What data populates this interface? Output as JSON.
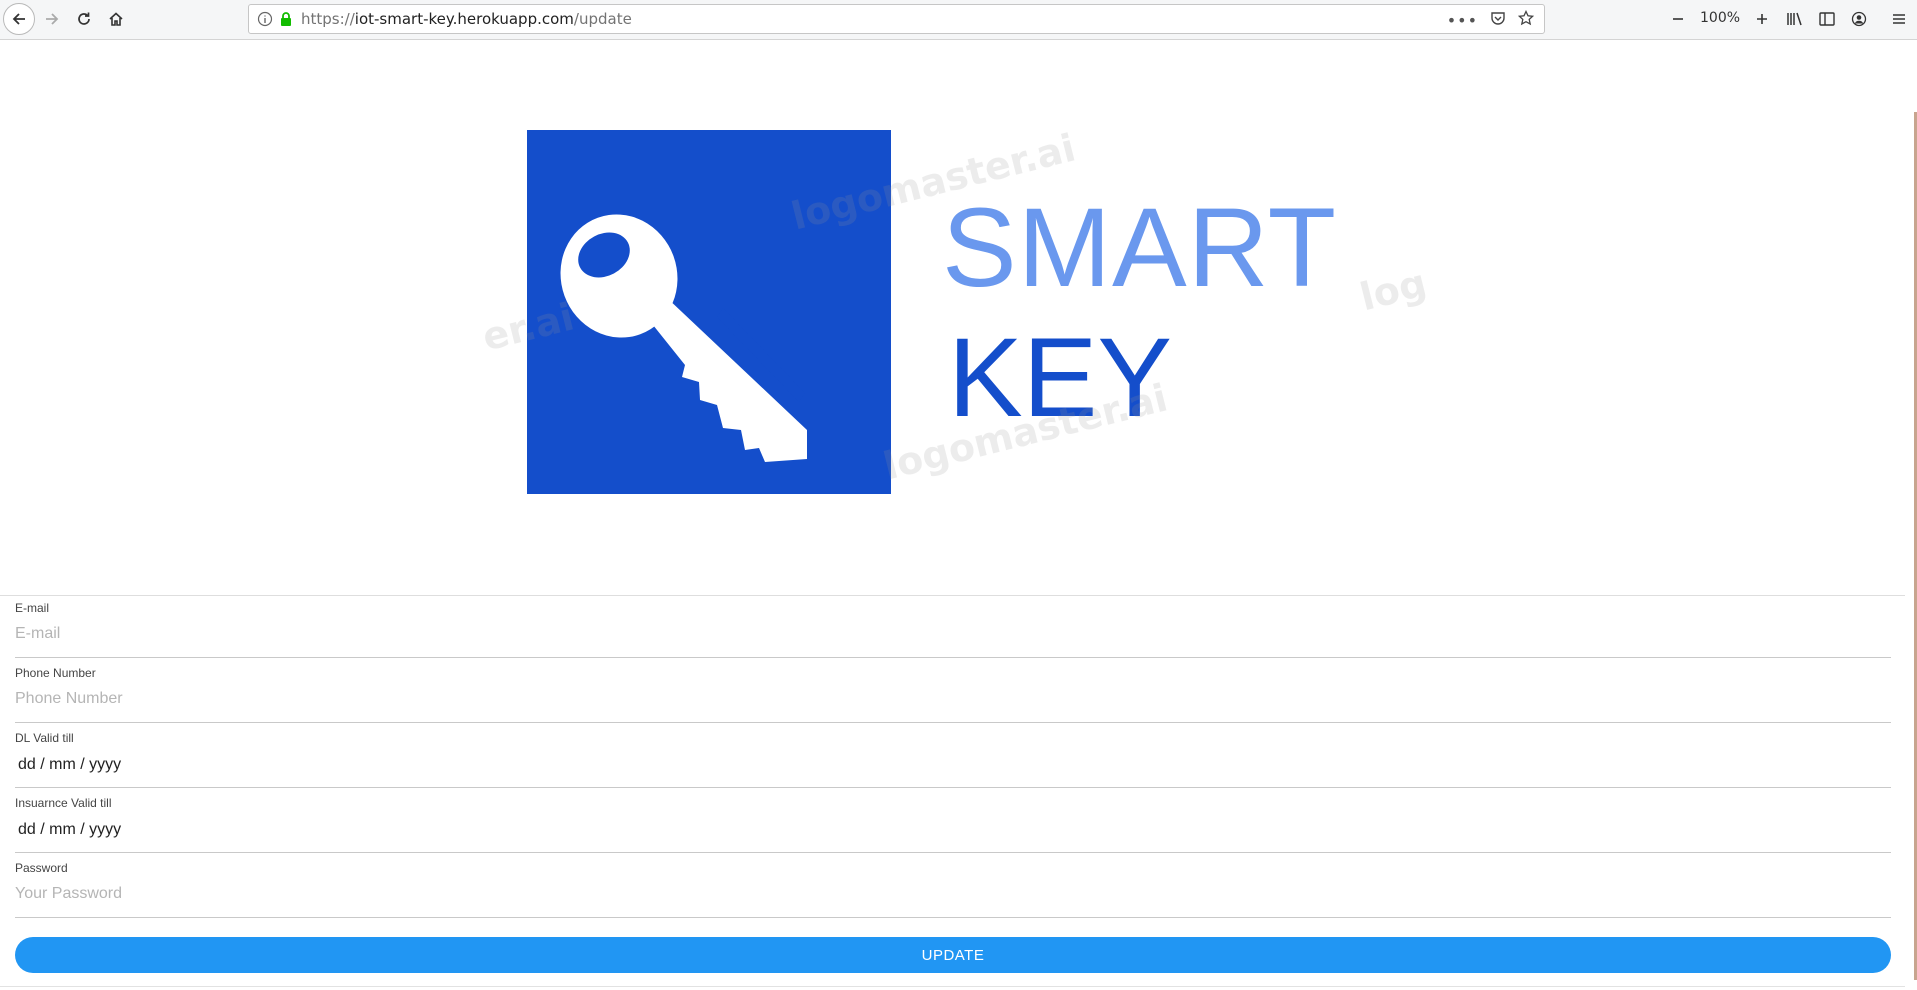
{
  "browser": {
    "url_protocol": "https://",
    "url_domain": "iot-smart-key.herokuapp.com",
    "url_path": "/update",
    "zoom_level": "100%"
  },
  "logo": {
    "line1": "SMART",
    "line2": "KEY",
    "watermark": "logomaster.ai",
    "watermark_fragment_1": "er.ai",
    "watermark_fragment_2": "log",
    "brand_color": "#144ecb",
    "accent_color": "#6a98ee"
  },
  "form": {
    "email": {
      "label": "E-mail",
      "placeholder": "E-mail"
    },
    "phone": {
      "label": "Phone Number",
      "placeholder": "Phone Number"
    },
    "dl_valid": {
      "label": "DL Valid till",
      "value": "dd / mm / yyyy"
    },
    "insurance_valid": {
      "label": "Insuarnce Valid till",
      "value": "dd / mm / yyyy"
    },
    "password": {
      "label": "Password",
      "placeholder": "Your Password"
    },
    "submit_label": "UPDATE",
    "button_color": "#2196f3"
  }
}
